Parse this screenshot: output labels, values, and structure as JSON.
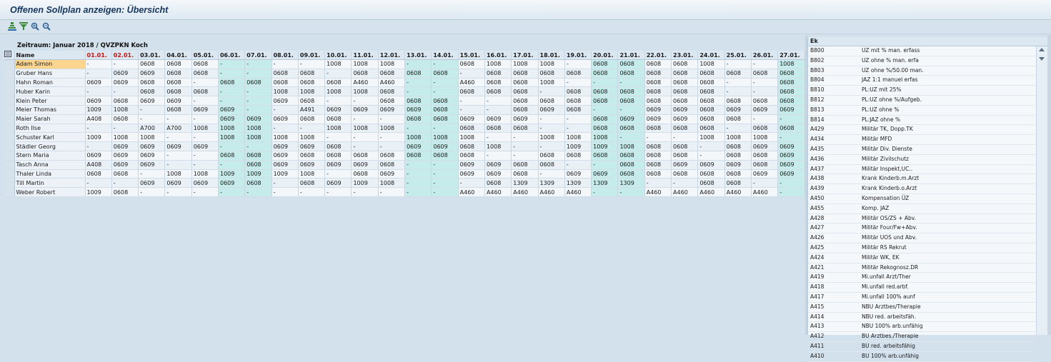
{
  "title": "Offenen Sollplan anzeigen: Übersicht",
  "toolbar": [
    {
      "icon": "sort-ascending-icon"
    },
    {
      "icon": "filter-icon"
    },
    {
      "icon": "zoom-in-icon"
    },
    {
      "icon": "zoom-out-icon"
    }
  ],
  "zeitraum": "Zeitraum: Januar 2018 / QVZPKN Koch",
  "grid": {
    "name_header": "Name",
    "dates": [
      "01.01.",
      "02.01.",
      "03.01.",
      "04.01.",
      "05.01.",
      "06.01.",
      "07.01.",
      "08.01.",
      "09.01.",
      "10.01.",
      "11.01.",
      "12.01.",
      "13.01.",
      "14.01.",
      "15.01.",
      "16.01.",
      "17.01.",
      "18.01.",
      "19.01.",
      "20.01.",
      "21.01.",
      "22.01.",
      "23.01.",
      "24.01.",
      "25.01.",
      "26.01.",
      "27.01."
    ],
    "weekend_dates": [
      0,
      1
    ],
    "highlight_cols": [
      5,
      6,
      12,
      13,
      19,
      20,
      26
    ],
    "rows": [
      {
        "name": "Adam Simon",
        "cells": [
          "-",
          "-",
          "0608",
          "0608",
          "0608",
          "-",
          "-",
          "-",
          "-",
          "1008",
          "1008",
          "1008",
          "-",
          "-",
          "0608",
          "1008",
          "1008",
          "1008",
          "-",
          "0608",
          "0608",
          "0608",
          "0608",
          "1008",
          "-",
          "-",
          "1008"
        ]
      },
      {
        "name": "Gruber Hans",
        "cells": [
          "-",
          "0609",
          "0609",
          "0608",
          "0608",
          "-",
          "-",
          "0608",
          "0608",
          "-",
          "0608",
          "0608",
          "0608",
          "0608",
          "-",
          "0608",
          "0608",
          "0608",
          "0608",
          "0608",
          "0608",
          "0608",
          "0608",
          "0608",
          "0608",
          "0608",
          "0608"
        ]
      },
      {
        "name": "Hahn Roman",
        "cells": [
          "0609",
          "0609",
          "0608",
          "0608",
          "-",
          "0608",
          "0608",
          "0608",
          "0608",
          "0608",
          "A460",
          "A460",
          "-",
          "-",
          "A460",
          "0608",
          "0608",
          "1008",
          "-",
          "-",
          "-",
          "0608",
          "0608",
          "0608",
          "-",
          "-",
          "0608"
        ]
      },
      {
        "name": "Huber Karin",
        "cells": [
          "-",
          "-",
          "0608",
          "0608",
          "0608",
          "-",
          "-",
          "1008",
          "1008",
          "1008",
          "1008",
          "0608",
          "-",
          "-",
          "0608",
          "0608",
          "0608",
          "-",
          "0608",
          "0608",
          "0608",
          "0608",
          "0608",
          "0608",
          "-",
          "-",
          "0608"
        ]
      },
      {
        "name": "Klein Peter",
        "cells": [
          "0609",
          "0608",
          "0609",
          "0609",
          "-",
          "-",
          "-",
          "0609",
          "0608",
          "-",
          "-",
          "0608",
          "0608",
          "0608",
          "-",
          "-",
          "0608",
          "0608",
          "0608",
          "0608",
          "0608",
          "0608",
          "0608",
          "0608",
          "0608",
          "0608",
          "0608"
        ]
      },
      {
        "name": "Meier Thomas",
        "cells": [
          "1009",
          "1008",
          "-",
          "0608",
          "0609",
          "0609",
          "-",
          "-",
          "A491",
          "0609",
          "0609",
          "0609",
          "0609",
          "0608",
          "-",
          "-",
          "0608",
          "0609",
          "0608",
          "-",
          "-",
          "0609",
          "0609",
          "0608",
          "0609",
          "0609",
          "0609"
        ]
      },
      {
        "name": "Maier Sarah",
        "cells": [
          "A408",
          "0608",
          "-",
          "-",
          "-",
          "0609",
          "0609",
          "0609",
          "0608",
          "0608",
          "-",
          "-",
          "0608",
          "0608",
          "0609",
          "0609",
          "0609",
          "-",
          "-",
          "0608",
          "0609",
          "0609",
          "0609",
          "0608",
          "0608",
          "-",
          "-"
        ]
      },
      {
        "name": "Roth Ilse",
        "cells": [
          "-",
          "-",
          "A700",
          "A700",
          "1008",
          "1008",
          "1008",
          "-",
          "-",
          "1008",
          "1008",
          "1008",
          "-",
          "-",
          "0608",
          "0608",
          "0608",
          "-",
          "-",
          "0608",
          "0608",
          "0608",
          "0608",
          "0608",
          "-",
          "0608",
          "0608"
        ]
      },
      {
        "name": "Schuster Karl",
        "cells": [
          "1009",
          "1008",
          "1008",
          "-",
          "-",
          "1008",
          "1008",
          "1008",
          "1008",
          "-",
          "-",
          "-",
          "1008",
          "1008",
          "1008",
          "-",
          "-",
          "1008",
          "1008",
          "1008",
          "-",
          "-",
          "-",
          "1008",
          "1008",
          "1008",
          "-"
        ]
      },
      {
        "name": "Städler Georg",
        "cells": [
          "-",
          "0609",
          "0609",
          "0609",
          "0609",
          "-",
          "-",
          "0609",
          "0609",
          "0608",
          "-",
          "-",
          "0609",
          "0609",
          "0608",
          "1008",
          "-",
          "-",
          "1009",
          "1009",
          "1008",
          "0608",
          "0608",
          "-",
          "0608",
          "0609",
          "0609"
        ]
      },
      {
        "name": "Stern Maria",
        "cells": [
          "0609",
          "0609",
          "0609",
          "-",
          "-",
          "0608",
          "0608",
          "0609",
          "0608",
          "0608",
          "0608",
          "0608",
          "0608",
          "0608",
          "0608",
          "-",
          "-",
          "0608",
          "0608",
          "0608",
          "0608",
          "0608",
          "0608",
          "-",
          "0608",
          "0608",
          "0609"
        ]
      },
      {
        "name": "Tasch Anna",
        "cells": [
          "A408",
          "0609",
          "0609",
          "-",
          "-",
          "-",
          "0608",
          "0609",
          "0609",
          "0609",
          "0609",
          "0608",
          "-",
          "-",
          "0609",
          "0609",
          "0608",
          "0608",
          "-",
          "-",
          "0608",
          "0608",
          "0609",
          "0609",
          "0609",
          "0608",
          "0609"
        ]
      },
      {
        "name": "Thaler Linda",
        "cells": [
          "0608",
          "0608",
          "-",
          "1008",
          "1008",
          "1009",
          "1009",
          "1009",
          "1008",
          "-",
          "0608",
          "0609",
          "-",
          "-",
          "0609",
          "0609",
          "0608",
          "-",
          "0609",
          "0609",
          "0608",
          "0608",
          "0608",
          "0608",
          "0608",
          "0609",
          "0609"
        ]
      },
      {
        "name": "Till Martin",
        "cells": [
          "-",
          "-",
          "0609",
          "0609",
          "0609",
          "0609",
          "0608",
          "-",
          "0608",
          "0609",
          "1009",
          "1008",
          "-",
          "-",
          "-",
          "0608",
          "1309",
          "1309",
          "1309",
          "1309",
          "1309",
          "-",
          "-",
          "0608",
          "0608",
          "-",
          "-"
        ]
      },
      {
        "name": "Weber Robert",
        "cells": [
          "1009",
          "0608",
          "-",
          "-",
          "-",
          "-",
          "-",
          "-",
          "-",
          "-",
          "-",
          "-",
          "-",
          "-",
          "A460",
          "A460",
          "A460",
          "A460",
          "A460",
          "-",
          "-",
          "A460",
          "A460",
          "A460",
          "A460",
          "A460",
          "-"
        ]
      }
    ]
  },
  "side": {
    "header": "Ek",
    "items": [
      {
        "code": "B800",
        "text": "UZ mit % man. erfass"
      },
      {
        "code": "B802",
        "text": "UZ ohne %  man. erfa"
      },
      {
        "code": "B803",
        "text": "UZ ohne %/50.00 man."
      },
      {
        "code": "B804",
        "text": "JAZ 1:1 manuel erfas"
      },
      {
        "code": "B810",
        "text": "PL:UZ mit 25%"
      },
      {
        "code": "B812",
        "text": "PL:UZ ohne %/Aufgeb."
      },
      {
        "code": "B813",
        "text": "PL:UZ ohne %"
      },
      {
        "code": "B814",
        "text": "PL:JAZ ohne %"
      },
      {
        "code": "A429",
        "text": "Militär TK, Dopp.TK"
      },
      {
        "code": "A434",
        "text": "Militär MFD"
      },
      {
        "code": "A435",
        "text": "Militär Div. Dienste"
      },
      {
        "code": "A436",
        "text": "Militär Zivilschutz"
      },
      {
        "code": "A437",
        "text": "Militär Inspekt,UC.."
      },
      {
        "code": "A438",
        "text": "Krank Kinderb.m.Arzt"
      },
      {
        "code": "A439",
        "text": "Krank Kinderb.o.Arzt"
      },
      {
        "code": "A450",
        "text": "Kompensation ÜZ"
      },
      {
        "code": "A455",
        "text": "Komp. JAZ"
      },
      {
        "code": "A428",
        "text": "Militär OS/ZS + Abv."
      },
      {
        "code": "A427",
        "text": "Militär Four/Fw+Abv."
      },
      {
        "code": "A426",
        "text": "Militär UOS und Abv."
      },
      {
        "code": "A425",
        "text": "Militär RS Rekrut"
      },
      {
        "code": "A424",
        "text": "Militär WK, EK"
      },
      {
        "code": "A421",
        "text": "Militär Rekognosz.DR"
      },
      {
        "code": "A419",
        "text": "Mi.unfall Arzt/Ther"
      },
      {
        "code": "A418",
        "text": "Mi.unfall red.arbf."
      },
      {
        "code": "A417",
        "text": "Mi.unfall 100% aunf"
      },
      {
        "code": "A415",
        "text": "NBU Arztbes/Therapie"
      },
      {
        "code": "A414",
        "text": "NBU red. arbeitsfäh."
      },
      {
        "code": "A413",
        "text": "NBU 100% arb.unfähig"
      },
      {
        "code": "A412",
        "text": "BU Arztbes./Therapie"
      },
      {
        "code": "A411",
        "text": "BU red. arbeitsfähig"
      },
      {
        "code": "A410",
        "text": "BU 100% arb.unfähig"
      }
    ]
  }
}
